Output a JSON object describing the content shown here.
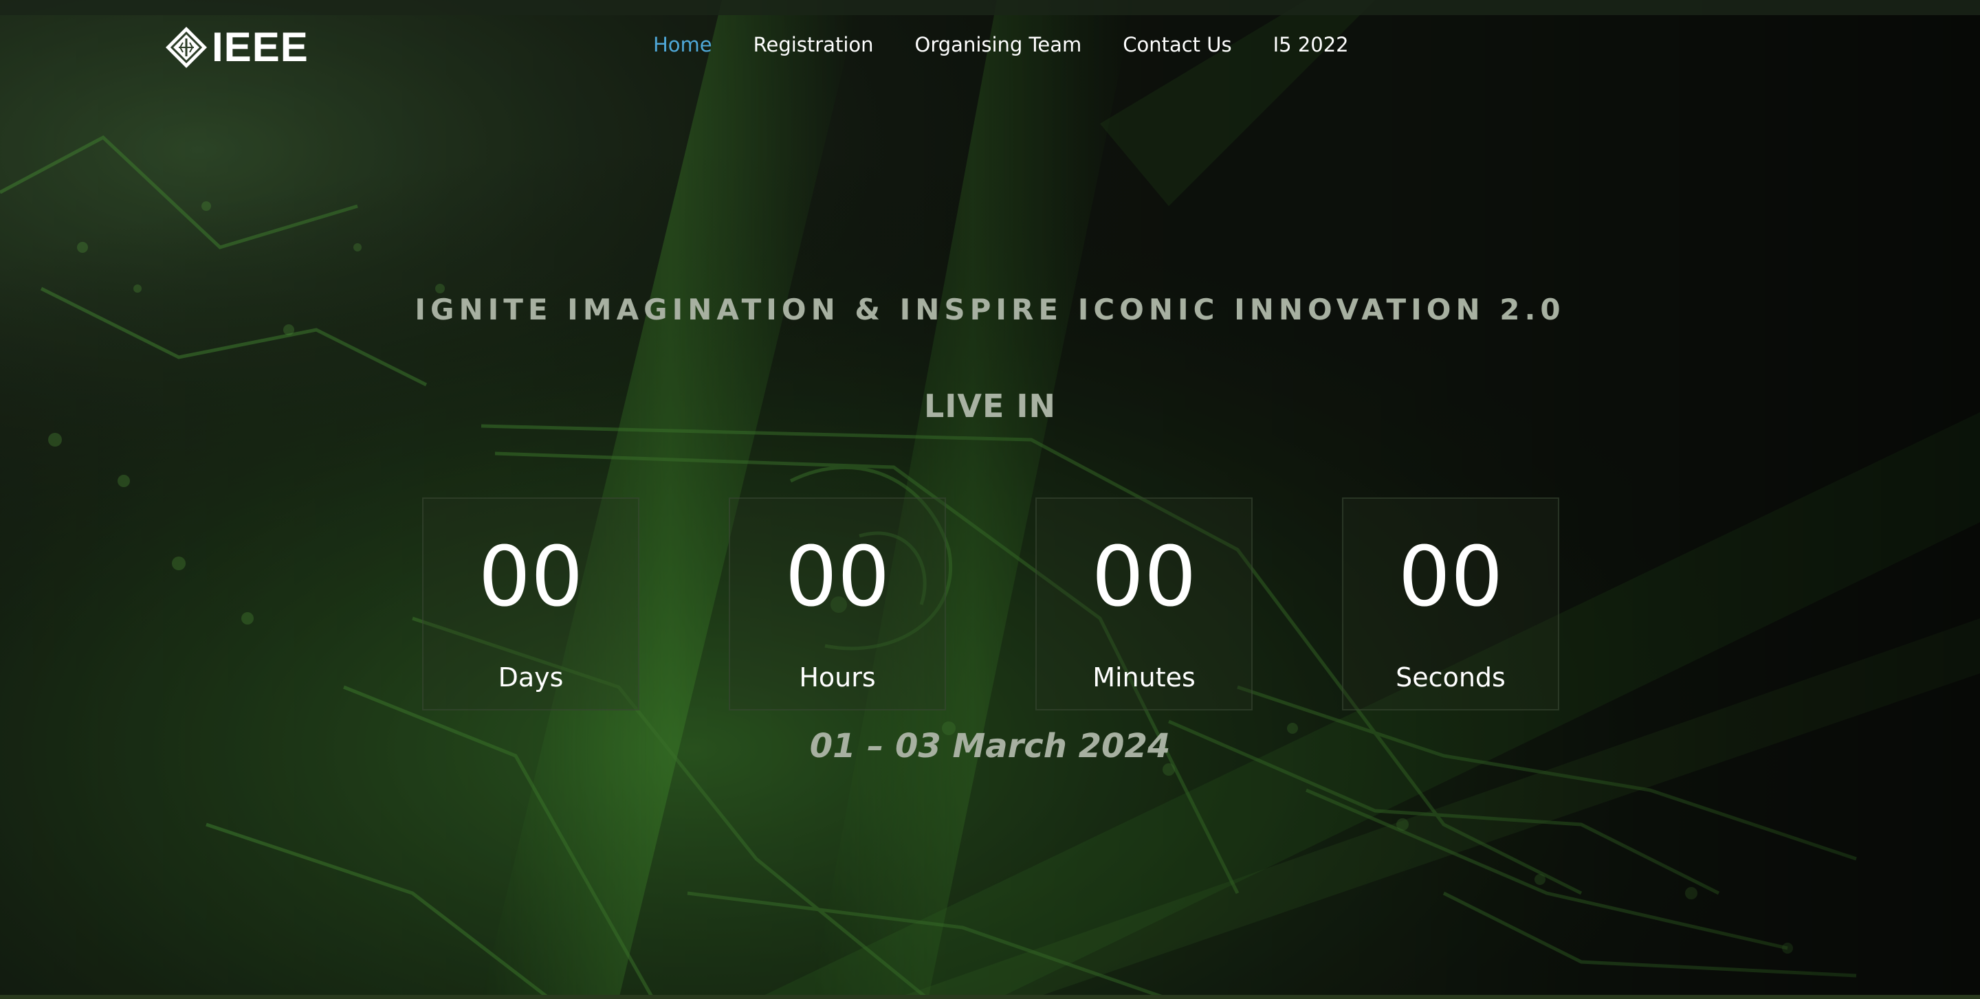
{
  "header": {
    "logo_text": "IEEE",
    "nav": [
      {
        "label": "Home",
        "active": true
      },
      {
        "label": "Registration",
        "active": false
      },
      {
        "label": "Organising Team",
        "active": false
      },
      {
        "label": "Contact Us",
        "active": false
      },
      {
        "label": "I5 2022",
        "active": false
      }
    ],
    "active_color": "#4fa8d8"
  },
  "hero": {
    "tagline": "IGNITE IMAGINATION & INSPIRE ICONIC INNOVATION 2.0",
    "live_in": "LIVE IN",
    "countdown": [
      {
        "value": "00",
        "label": "Days"
      },
      {
        "value": "00",
        "label": "Hours"
      },
      {
        "value": "00",
        "label": "Minutes"
      },
      {
        "value": "00",
        "label": "Seconds"
      }
    ],
    "date": "01 – 03 March 2024",
    "background_color": "#1f3a1a"
  },
  "icons": {
    "logo": "ieee-diamond-icon",
    "background": "circuit-board-image"
  }
}
